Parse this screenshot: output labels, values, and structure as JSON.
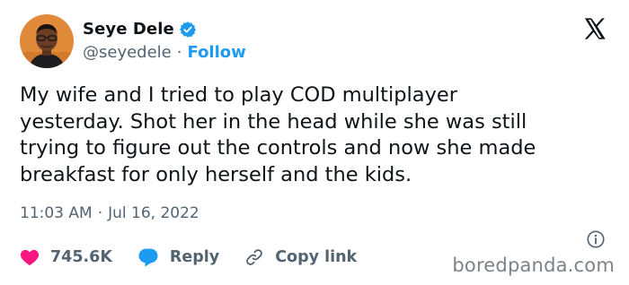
{
  "author": {
    "display_name": "Seye Dele",
    "handle": "@seyedele",
    "separator": "·",
    "follow_label": "Follow",
    "verified_icon": "verified-badge-icon"
  },
  "tweet": {
    "text": "My wife and I tried to play COD multiplayer\nyesterday. Shot her in the head while she was still\ntrying to figure out the controls and now she made\nbreakfast for only herself and the kids.",
    "time": "11:03 AM",
    "separator": "·",
    "date": "Jul 16, 2022"
  },
  "actions": {
    "likes_count": "745.6K",
    "reply_label": "Reply",
    "copy_link_label": "Copy link"
  },
  "watermark": "boredpanda.com",
  "colors": {
    "accent": "#1d9bf0",
    "like": "#f91880",
    "text": "#0f1419",
    "muted": "#536471"
  }
}
